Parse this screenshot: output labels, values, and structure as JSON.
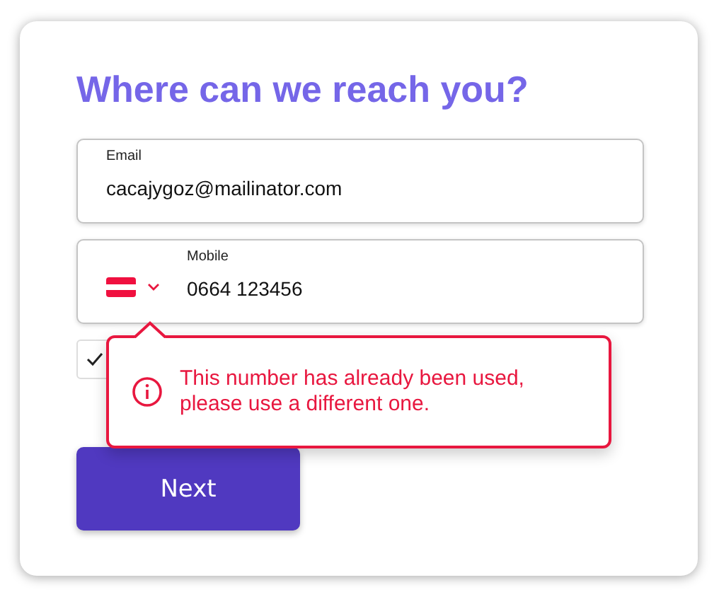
{
  "title": "Where can we reach you?",
  "email": {
    "label": "Email",
    "value": "cacajygoz@mailinator.com"
  },
  "mobile": {
    "label": "Mobile",
    "value": "0664 123456"
  },
  "checkbox": {
    "checked": true
  },
  "error": {
    "message": "This number has already been used, please use a different one."
  },
  "button": {
    "label": "Next"
  }
}
